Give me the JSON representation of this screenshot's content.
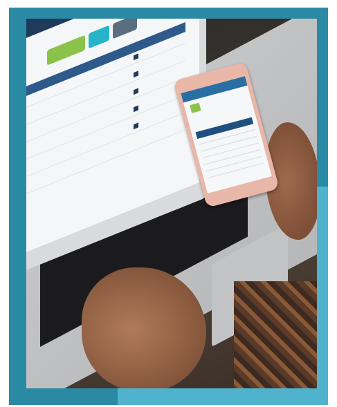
{
  "scene": {
    "description_subject": "laptop-and-phone",
    "colors": {
      "frame_dark_teal": "#2a8aa3",
      "frame_light_teal": "#4fb3ce",
      "screen_header_navy": "#1f3b5c",
      "accent_green": "#8bc34a",
      "accent_teal": "#26b4c9"
    }
  },
  "laptop_screen": {
    "buttons": [
      "",
      "",
      ""
    ]
  },
  "phone_screen": {
    "header": ""
  }
}
